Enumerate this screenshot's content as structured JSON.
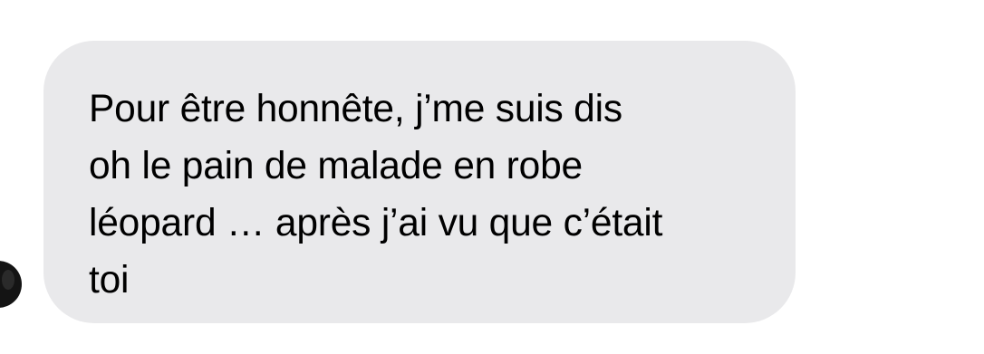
{
  "conversation": {
    "messages": [
      {
        "direction": "incoming",
        "lines": [
          "Pour être honnête, j’me suis dis",
          "oh le pain de malade en robe",
          "léopard … après j’ai vu que c’était",
          "toi"
        ]
      }
    ]
  },
  "colors": {
    "bubble_background": "#e9e9eb",
    "text": "#000000",
    "avatar": "#141414",
    "page_background": "#ffffff"
  },
  "icons": {
    "avatar": "contact-avatar-icon"
  }
}
